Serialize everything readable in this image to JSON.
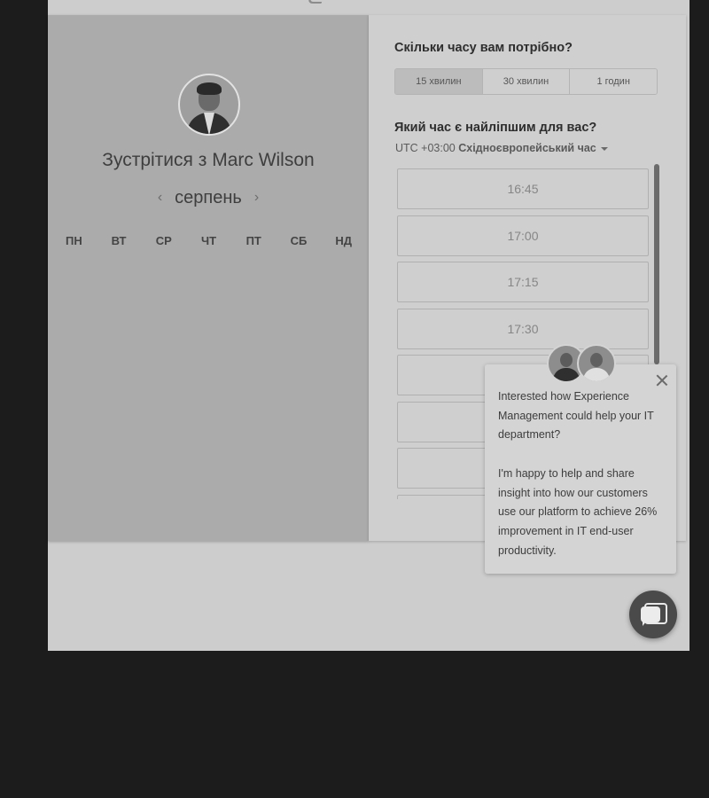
{
  "scheduler": {
    "host": {
      "title": "Зустрітися з Marc Wilson"
    },
    "calendar": {
      "month": "серпень",
      "prev_icon": "‹",
      "next_icon": "›",
      "weekdays": [
        "ПН",
        "ВТ",
        "СР",
        "ЧТ",
        "ПТ",
        "СБ",
        "НД"
      ]
    },
    "duration": {
      "question": "Скільки часу вам потрібно?",
      "options": [
        "15 хвилин",
        "30 хвилин",
        "1 годин"
      ],
      "selected": "15 хвилин"
    },
    "time": {
      "question": "Який час є найліпшим для вас?",
      "timezone_offset": "UTC +03:00",
      "timezone_name": "Східноєвропейський час",
      "slots": [
        "16:45",
        "17:00",
        "17:15",
        "17:30",
        "",
        "",
        "",
        ""
      ]
    }
  },
  "chat": {
    "message_1": "Interested how Experience Management could help your IT department?",
    "message_2": "I'm happy to help and share insight into how our customers use our platform to achieve 26% improvement in IT end-user productivity.",
    "close_icon": "close-icon",
    "launcher_icon": "chat-bubble-icon"
  }
}
